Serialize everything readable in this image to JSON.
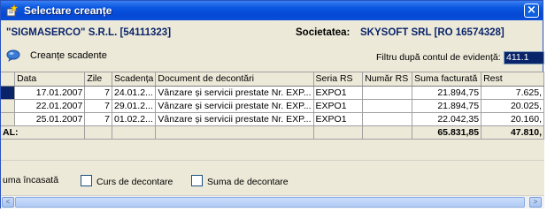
{
  "window": {
    "title": "Selectare creanțe",
    "close_label": "×"
  },
  "header": {
    "client": "\"SIGMASERCO\" S.R.L. [54111323]",
    "societatea_label": "Societatea:",
    "societatea_value": "SKYSOFT SRL [RO 16574328]"
  },
  "toolbar": {
    "creante_label": "Creanțe scadente",
    "filtru_label": "Filtru după contul de evidență:",
    "filtru_value": "411.1"
  },
  "grid": {
    "columns": [
      "Data",
      "Zile",
      "Scadența",
      "Document de decontări",
      "Seria RS",
      "Număr RS",
      "Suma facturată",
      "Rest"
    ],
    "rows": [
      {
        "data": "17.01.2007",
        "zile": "7",
        "scadenta": "24.01.2...",
        "document": "Vânzare și servicii prestate Nr. EXP...",
        "seria": "EXPO1",
        "numar": "",
        "suma": "21.894,75",
        "rest": "7.625,"
      },
      {
        "data": "22.01.2007",
        "zile": "7",
        "scadenta": "29.01.2...",
        "document": "Vânzare și servicii prestate Nr. EXP...",
        "seria": "EXPO1",
        "numar": "",
        "suma": "21.894,75",
        "rest": "20.025,"
      },
      {
        "data": "25.01.2007",
        "zile": "7",
        "scadenta": "01.02.2...",
        "document": "Vânzare și servicii prestate Nr. EXP...",
        "seria": "EXPO1",
        "numar": "",
        "suma": "22.042,35",
        "rest": "20.160,"
      }
    ],
    "total_label": "AL:",
    "total_suma": "65.831,85",
    "total_rest": "47.810,"
  },
  "options": {
    "suma_incasata": "uma încasată",
    "curs": "Curs de decontare",
    "suma_decontare": "Suma de decontare"
  },
  "scrollbar": {
    "left_arrow": "<",
    "right_arrow": ">"
  }
}
